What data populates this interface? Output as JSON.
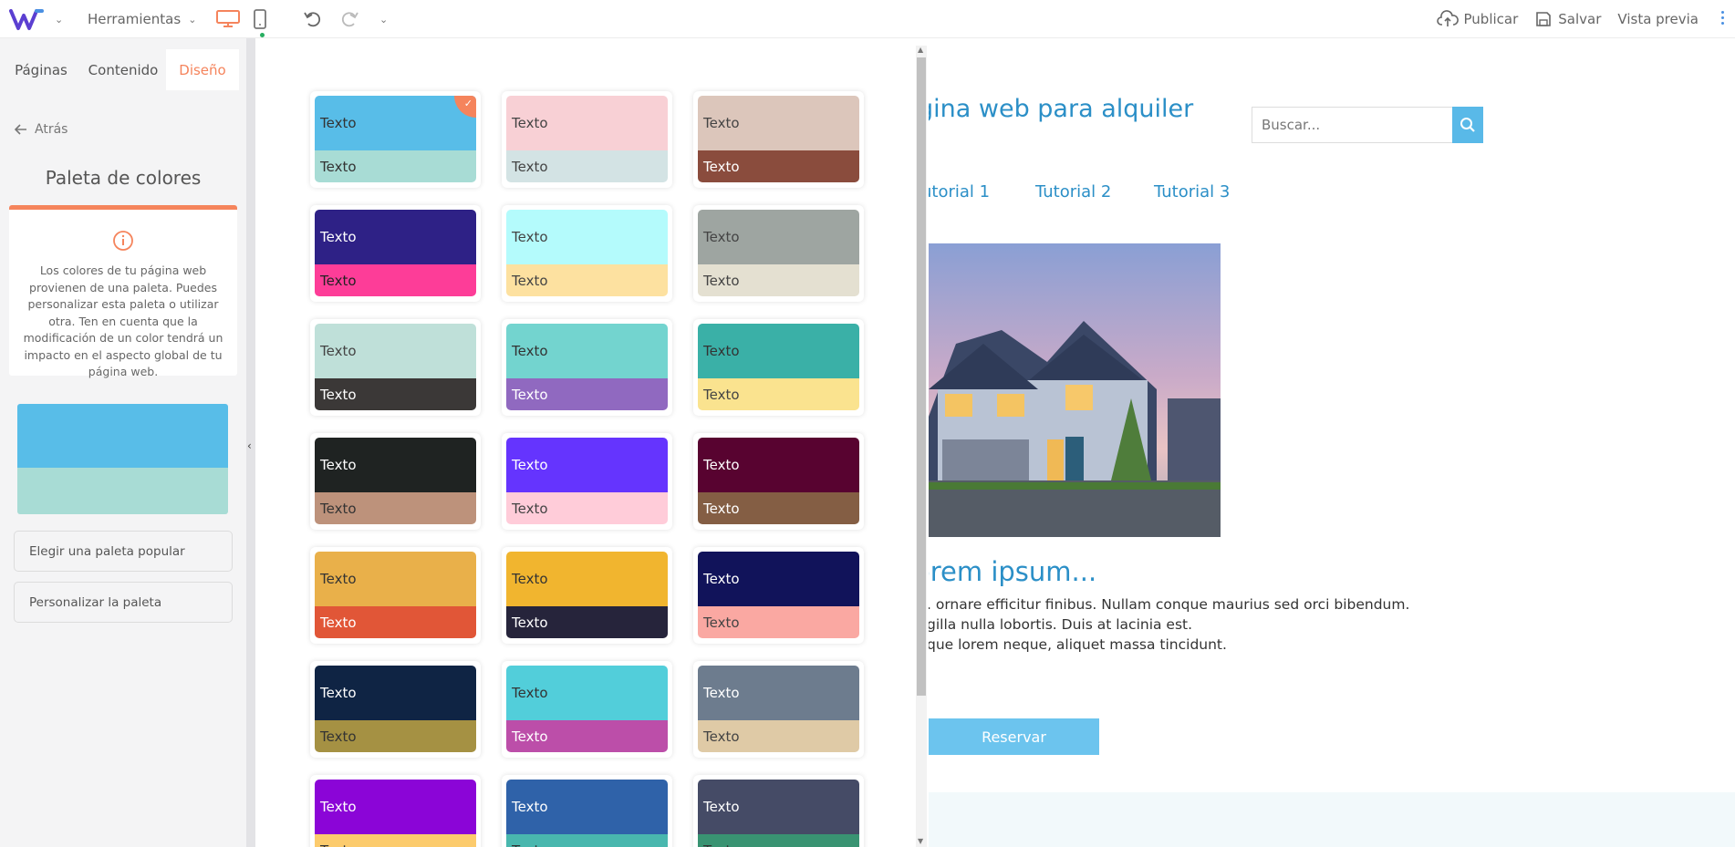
{
  "topbar": {
    "tools_label": "Herramientas",
    "publish_label": "Publicar",
    "save_label": "Salvar",
    "preview_label": "Vista previa",
    "accent": "#f5845c"
  },
  "sidebar": {
    "tabs": [
      "Páginas",
      "Contenido",
      "Diseño"
    ],
    "active_tab": "Diseño",
    "back_label": "Atrás",
    "title": "Paleta de colores",
    "info_text": "Los colores de tu página web provienen de una paleta. Puedes personalizar esta paleta o utilizar otra. Ten en cuenta que la modificación de un color tendrá un impacto en el aspecto global de tu página web.",
    "current_palette": {
      "top": "#58bde8",
      "bottom": "#a8dcd5"
    },
    "buttons": [
      "Elegir una paleta popular",
      "Personalizar la paleta"
    ]
  },
  "palettes": [
    {
      "label": "Texto",
      "top": "#58bde8",
      "bottom": "#a8dcd5",
      "top_text": "#333333",
      "bottom_text": "#333333",
      "selected": true
    },
    {
      "label": "Texto",
      "top": "#f8d0d5",
      "bottom": "#d3e3e4",
      "top_text": "#444444",
      "bottom_text": "#444444"
    },
    {
      "label": "Texto",
      "top": "#dcc6bb",
      "bottom": "#8a4c3d",
      "top_text": "#444444",
      "bottom_text": "#ffffff"
    },
    {
      "label": "Texto",
      "top": "#2e2186",
      "bottom": "#fd3d98",
      "top_text": "#ffffff",
      "bottom_text": "#222222"
    },
    {
      "label": "Texto",
      "top": "#b4fbfc",
      "bottom": "#fde1a0",
      "top_text": "#444444",
      "bottom_text": "#444444"
    },
    {
      "label": "Texto",
      "top": "#9ea5a1",
      "bottom": "#e4e0d1",
      "top_text": "#444444",
      "bottom_text": "#444444"
    },
    {
      "label": "Texto",
      "top": "#bfe0d9",
      "bottom": "#3b3837",
      "top_text": "#444444",
      "bottom_text": "#ffffff"
    },
    {
      "label": "Texto",
      "top": "#73d4cf",
      "bottom": "#9069c0",
      "top_text": "#333333",
      "bottom_text": "#ffffff"
    },
    {
      "label": "Texto",
      "top": "#3ab0a7",
      "bottom": "#fae38f",
      "top_text": "#333333",
      "bottom_text": "#444444"
    },
    {
      "label": "Texto",
      "top": "#1f2322",
      "bottom": "#bd927b",
      "top_text": "#ffffff",
      "bottom_text": "#333333"
    },
    {
      "label": "Texto",
      "top": "#6534fe",
      "bottom": "#ffccd9",
      "top_text": "#ffffff",
      "bottom_text": "#444444"
    },
    {
      "label": "Texto",
      "top": "#580330",
      "bottom": "#845e44",
      "top_text": "#ffffff",
      "bottom_text": "#ffffff"
    },
    {
      "label": "Texto",
      "top": "#e9b04a",
      "bottom": "#e15637",
      "top_text": "#333333",
      "bottom_text": "#ffffff"
    },
    {
      "label": "Texto",
      "top": "#f1b52f",
      "bottom": "#26243b",
      "top_text": "#333333",
      "bottom_text": "#ffffff"
    },
    {
      "label": "Texto",
      "top": "#11135a",
      "bottom": "#faa8a2",
      "top_text": "#ffffff",
      "bottom_text": "#444444"
    },
    {
      "label": "Texto",
      "top": "#0f2444",
      "bottom": "#a59143",
      "top_text": "#ffffff",
      "bottom_text": "#333333"
    },
    {
      "label": "Texto",
      "top": "#52ceda",
      "bottom": "#bc4ea9",
      "top_text": "#333333",
      "bottom_text": "#ffffff"
    },
    {
      "label": "Texto",
      "top": "#6d7c8e",
      "bottom": "#dfcaa6",
      "top_text": "#ffffff",
      "bottom_text": "#444444"
    },
    {
      "label": "Texto",
      "top": "#8b05d7",
      "bottom": "#fccb6d",
      "top_text": "#ffffff",
      "bottom_text": "#333333"
    },
    {
      "label": "Texto",
      "top": "#2f62a9",
      "bottom": "#49b7ae",
      "top_text": "#ffffff",
      "bottom_text": "#333333"
    },
    {
      "label": "Texto",
      "top": "#454b66",
      "bottom": "#399372",
      "top_text": "#ffffff",
      "bottom_text": "#333333"
    }
  ],
  "site": {
    "title": "gina web para alquiler",
    "search_placeholder": "Buscar...",
    "nav": [
      "utorial 1",
      "Tutorial 2",
      "Tutorial 3"
    ],
    "heading": "orem ipsum...",
    "paragraph": ". ornare efficitur finibus. Nullam conque maurius sed orci bibendum.\ngilla nulla lobortis. Duis at lacinia est.\nque lorem neque, aliquet massa tincidunt.",
    "button_label": "Reservar",
    "link_color": "#2b8fc7"
  }
}
